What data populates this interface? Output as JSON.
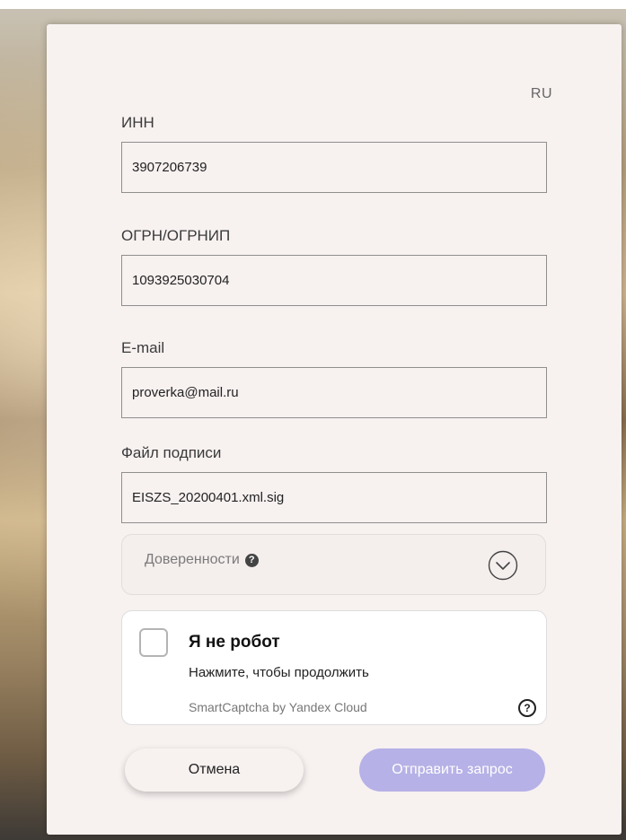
{
  "lang": "RU",
  "form": {
    "inn": {
      "label": "ИНН",
      "value": "3907206739"
    },
    "ogrn": {
      "label": "ОГРН/ОГРНИП",
      "value": "1093925030704"
    },
    "email": {
      "label": "E-mail",
      "value": "proverka@mail.ru"
    },
    "signature": {
      "label": "Файл подписи",
      "value": "EISZS_20200401.xml.sig"
    }
  },
  "power_of_attorney": {
    "label": "Доверенности"
  },
  "captcha": {
    "title": "Я не робот",
    "subtitle": "Нажмите, чтобы продолжить",
    "brand": "SmartCaptcha by Yandex Cloud",
    "checked": false
  },
  "buttons": {
    "cancel": "Отмена",
    "submit": "Отправить запрос"
  },
  "colors": {
    "submit_bg": "#b6b1e6",
    "modal_bg": "#f7f1f0"
  },
  "icons": {
    "help": "question-circle-icon",
    "expand": "chevron-down-circle-icon"
  }
}
